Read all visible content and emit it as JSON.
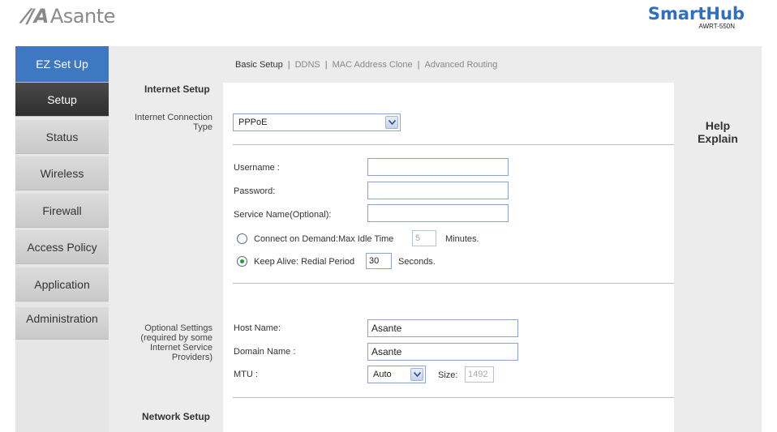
{
  "header": {
    "logo_text": "Asante",
    "brand_name": "SmartHub",
    "model": "AWRT-550N"
  },
  "sidebar": {
    "items": [
      {
        "label": "EZ Set Up"
      },
      {
        "label": "Setup"
      },
      {
        "label": "Status"
      },
      {
        "label": "Wireless"
      },
      {
        "label": "Firewall"
      },
      {
        "label": "Access Policy"
      },
      {
        "label": "Application"
      },
      {
        "label": "Administration"
      }
    ]
  },
  "tabs": {
    "basic_setup": "Basic Setup",
    "ddns": "DDNS",
    "mac_clone": "MAC Address Clone",
    "advanced_routing": "Advanced Routing",
    "separator": "|"
  },
  "internet_setup": {
    "title": "Internet Setup",
    "connection_type_label_line1": "Internet Connection",
    "connection_type_label_line2": "Type",
    "connection_type_value": "PPPoE",
    "username_label": "Username :",
    "username_value": "",
    "password_label": "Password:",
    "password_value": "",
    "service_name_label": "Service Name(Optional):",
    "service_name_value": "",
    "connect_on_demand_label": "Connect on Demand:Max Idle Time",
    "max_idle_value": "5",
    "minutes_label": "Minutes.",
    "keep_alive_label": "Keep Alive: Redial Period",
    "redial_value": "30",
    "seconds_label": "Seconds."
  },
  "optional_settings": {
    "label_line1": "Optional Settings",
    "label_line2": "(required by some",
    "label_line3": "Internet Service",
    "label_line4": "Providers)",
    "host_name_label": "Host Name:",
    "host_name_value": "Asante",
    "domain_name_label": "Domain Name :",
    "domain_name_value": "Asante",
    "mtu_label": "MTU :",
    "mtu_value": "Auto",
    "size_label": "Size:",
    "size_value": "1492"
  },
  "network_setup": {
    "title": "Network Setup"
  },
  "help": {
    "line1": "Help",
    "line2": "Explain"
  },
  "colors": {
    "accent": "#3d78c0",
    "brand": "#2f6fc0",
    "active_nav": "#3a3a3a",
    "radio_checked": "#2c9a3a"
  }
}
